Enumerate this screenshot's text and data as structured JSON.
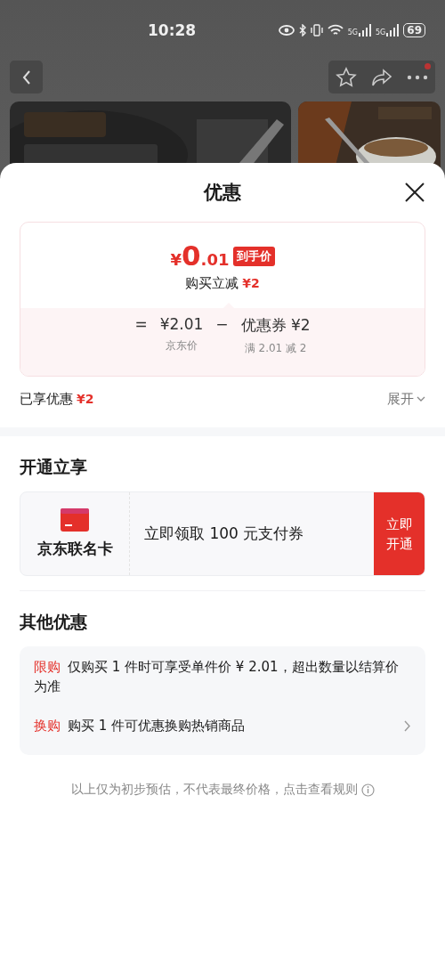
{
  "status_bar": {
    "time": "10:28",
    "network_labels": [
      "5G",
      "5G"
    ],
    "battery": "69"
  },
  "sheet": {
    "title": "优惠",
    "price_card": {
      "currency": "¥",
      "integer": "0",
      "fraction": ".01",
      "badge": "到手价",
      "saving_label": "购买立减",
      "saving": "¥2",
      "formula": [
        {
          "kind": "op",
          "text": "="
        },
        {
          "kind": "term",
          "value": "¥2.01",
          "caption": "京东价"
        },
        {
          "kind": "op",
          "text": "−"
        },
        {
          "kind": "term",
          "value": "优惠券 ¥2",
          "caption": "满 2.01 减 2"
        }
      ]
    },
    "enjoyed": {
      "label": "已享优惠",
      "amount": "¥2",
      "expand": "展开"
    },
    "open_section": {
      "heading": "开通立享",
      "card_name": "京东联名卡",
      "offer": "立即领取 100 元支付券",
      "button": "立即开通"
    },
    "other_section": {
      "heading": "其他优惠",
      "items": [
        {
          "tag": "限购",
          "text": "仅购买 1 件时可享受单件价 ¥ 2.01，超出数量以结算价为准",
          "has_arrow": false
        },
        {
          "tag": "换购",
          "text": "购买 1 件可优惠换购热销商品",
          "has_arrow": true
        }
      ]
    },
    "footer": "以上仅为初步预估，不代表最终价格，点击查看规则"
  }
}
